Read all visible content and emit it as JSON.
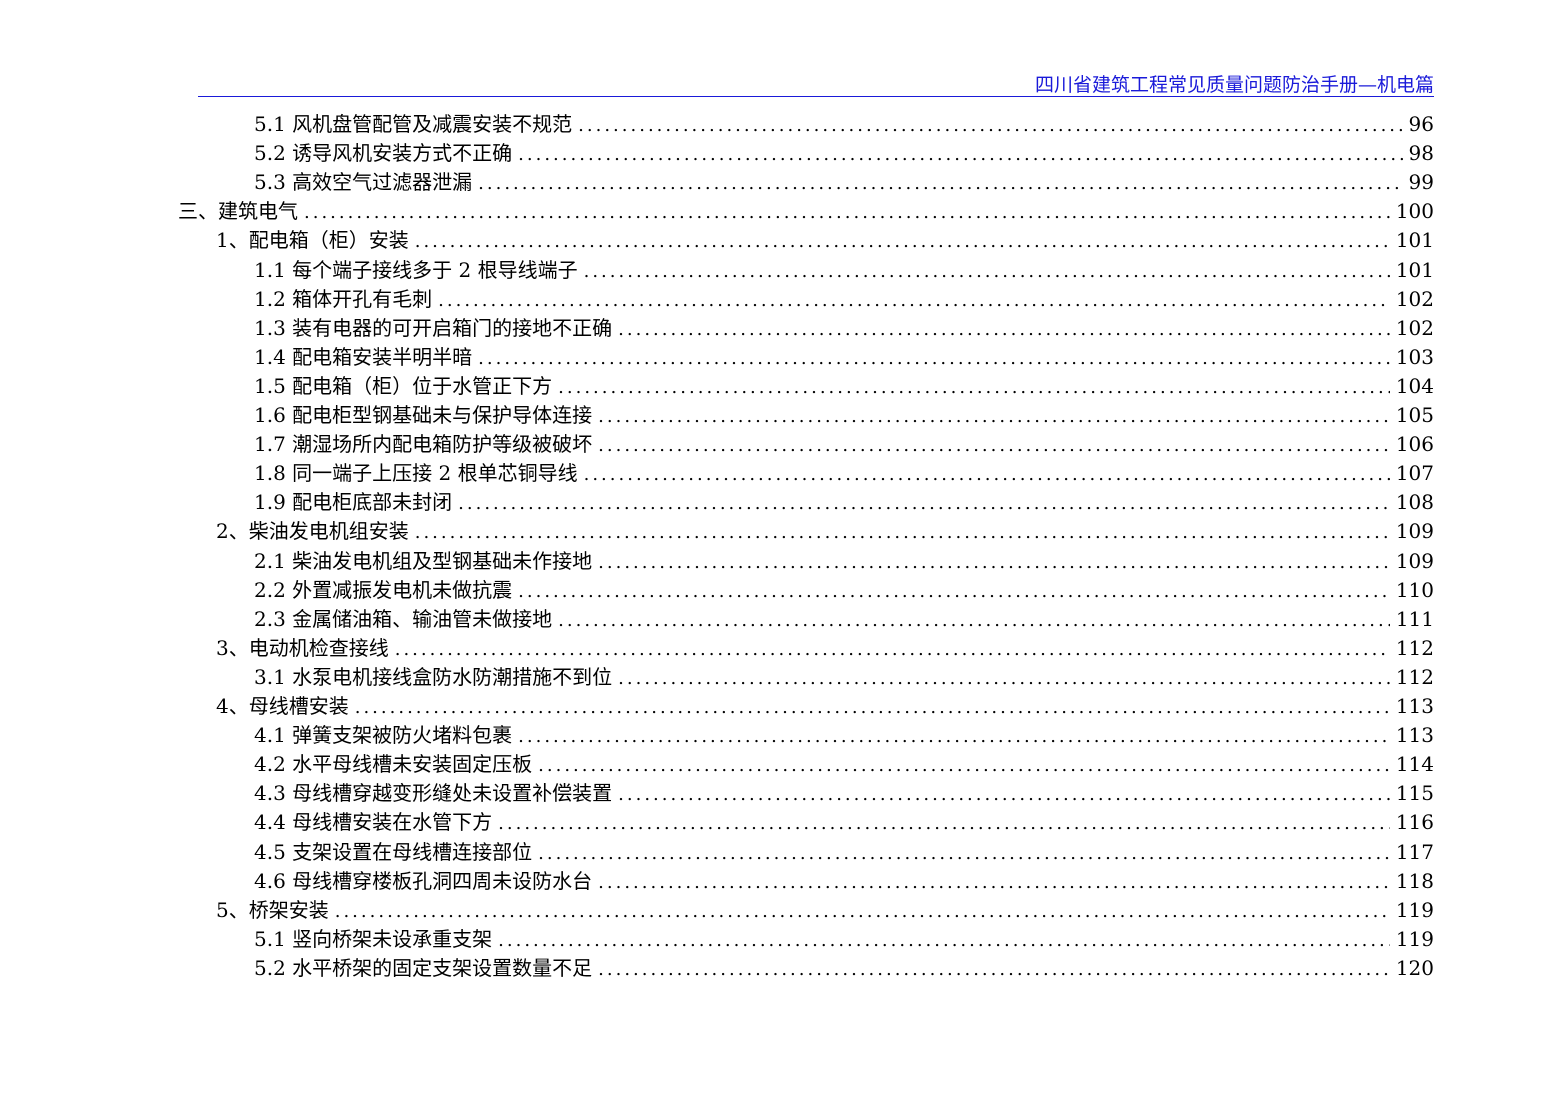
{
  "header": {
    "title": "四川省建筑工程常见质量问题防治手册—机电篇"
  },
  "toc": [
    {
      "level": 3,
      "label": "5.1 风机盘管配管及减震安装不规范",
      "page": "96"
    },
    {
      "level": 3,
      "label": "5.2 诱导风机安装方式不正确",
      "page": "98"
    },
    {
      "level": 3,
      "label": "5.3 高效空气过滤器泄漏",
      "page": "99"
    },
    {
      "level": 1,
      "label": "三、建筑电气",
      "page": "100"
    },
    {
      "level": 2,
      "label": "1、配电箱（柜）安装",
      "page": "101"
    },
    {
      "level": 3,
      "label": "1.1 每个端子接线多于 2 根导线端子",
      "page": "101"
    },
    {
      "level": 3,
      "label": "1.2 箱体开孔有毛刺",
      "page": "102"
    },
    {
      "level": 3,
      "label": "1.3 装有电器的可开启箱门的接地不正确",
      "page": "102"
    },
    {
      "level": 3,
      "label": "1.4 配电箱安装半明半暗",
      "page": "103"
    },
    {
      "level": 3,
      "label": "1.5 配电箱（柜）位于水管正下方",
      "page": "104"
    },
    {
      "level": 3,
      "label": "1.6 配电柜型钢基础未与保护导体连接",
      "page": "105"
    },
    {
      "level": 3,
      "label": "1.7 潮湿场所内配电箱防护等级被破坏",
      "page": "106"
    },
    {
      "level": 3,
      "label": "1.8 同一端子上压接 2 根单芯铜导线",
      "page": "107"
    },
    {
      "level": 3,
      "label": "1.9 配电柜底部未封闭",
      "page": "108"
    },
    {
      "level": 2,
      "label": "2、柴油发电机组安装",
      "page": "109"
    },
    {
      "level": 3,
      "label": "2.1 柴油发电机组及型钢基础未作接地",
      "page": "109"
    },
    {
      "level": 3,
      "label": "2.2 外置减振发电机未做抗震",
      "page": "110"
    },
    {
      "level": 3,
      "label": "2.3 金属储油箱、输油管未做接地",
      "page": "111"
    },
    {
      "level": 2,
      "label": "3、电动机检查接线",
      "page": "112"
    },
    {
      "level": 3,
      "label": "3.1 水泵电机接线盒防水防潮措施不到位",
      "page": "112"
    },
    {
      "level": 2,
      "label": "4、母线槽安装",
      "page": "113"
    },
    {
      "level": 3,
      "label": "4.1 弹簧支架被防火堵料包裹",
      "page": "113"
    },
    {
      "level": 3,
      "label": "4.2 水平母线槽未安装固定压板",
      "page": "114"
    },
    {
      "level": 3,
      "label": "4.3 母线槽穿越变形缝处未设置补偿装置",
      "page": "115"
    },
    {
      "level": 3,
      "label": "4.4 母线槽安装在水管下方",
      "page": "116"
    },
    {
      "level": 3,
      "label": "4.5 支架设置在母线槽连接部位",
      "page": "117"
    },
    {
      "level": 3,
      "label": "4.6 母线槽穿楼板孔洞四周未设防水台",
      "page": "118"
    },
    {
      "level": 2,
      "label": "5、桥架安装",
      "page": "119"
    },
    {
      "level": 3,
      "label": "5.1 竖向桥架未设承重支架",
      "page": "119"
    },
    {
      "level": 3,
      "label": "5.2 水平桥架的固定支架设置数量不足",
      "page": "120"
    }
  ],
  "colors": {
    "header_text": "#1a1ad9",
    "header_rule": "#1a1ad9",
    "body_text": "#000000"
  }
}
